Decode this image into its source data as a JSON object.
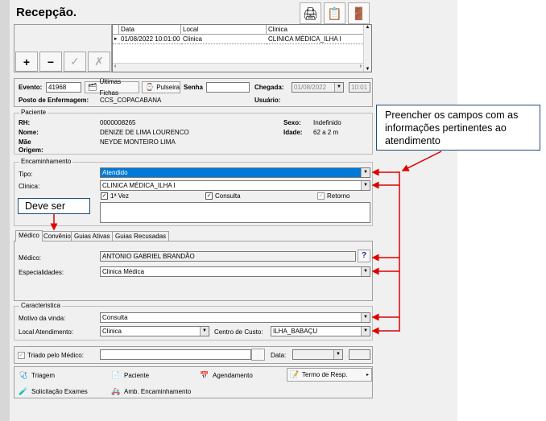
{
  "window": {
    "title": "Recepção."
  },
  "toolbar_icons": [
    "printer-icon",
    "checklist-icon",
    "exit-door-icon"
  ],
  "record_buttons": {
    "add": "+",
    "remove": "−",
    "confirm": "✓",
    "cancel": "✗"
  },
  "grid": {
    "headers": [
      "Data",
      "Local",
      "Clinica"
    ],
    "rows": [
      {
        "data": "01/08/2022 10:01:00",
        "local": "Clinica",
        "clinica": "CLINICA MÉDICA_ILHA I"
      }
    ]
  },
  "event": {
    "evento_label": "Evento:",
    "evento_value": "41968",
    "ultimas_fichas": "Últimas Fichas",
    "pulseira": "Pulseira",
    "senha_label": "Senha",
    "senha_value": "",
    "chegada_label": "Chegada:",
    "chegada_date": "01/08/2022",
    "chegada_time": "10:01",
    "posto_label": "Posto de Enfermagem:",
    "posto_value": "CCS_COPACABANA",
    "usuario_label": "Usuário:"
  },
  "paciente": {
    "group_title": "Paciente",
    "rh_label": "RH:",
    "rh_value": "0000008265",
    "nome_label": "Nome:",
    "nome_value": "DENIZE DE LIMA LOURENCO",
    "mae_label": "Mãe",
    "mae_value": "NEYDE MONTEIRO LIMA",
    "origem_label": "Origem:",
    "sexo_label": "Sexo:",
    "sexo_value": "Indefinido",
    "idade_label": "Idade:",
    "idade_value": "62 a 2 m"
  },
  "encaminhamento": {
    "group_title": "Encaminhamento",
    "tipo_label": "Tipo:",
    "tipo_value": "Atendido",
    "clinica_label": "Clinica:",
    "clinica_value": "CLINICA MÉDICA_ILHA I",
    "primeira_vez": "1ª Vez",
    "consulta": "Consulta",
    "retorno": "Retorno"
  },
  "tabs": [
    "Médico",
    "Convênio",
    "Guias Ativas",
    "Guias Recusadas"
  ],
  "medico": {
    "medico_label": "Médico:",
    "medico_value": "ANTONIO GABRIEL BRANDÃO",
    "help": "?",
    "especialidades_label": "Especialidades:",
    "especialidades_value": "Clinica Médica"
  },
  "caracteristica": {
    "group_title": "Caracteristica",
    "motivo_label": "Motivo da vinda:",
    "motivo_value": "Consulta",
    "local_label": "Local Atendimento:",
    "local_value": "Clinica",
    "centro_label": "Centro de Custo:",
    "centro_value": "ILHA_BABAÇU"
  },
  "triado": {
    "label": "Triado pelo Médico:",
    "data_label": "Data:"
  },
  "actions": {
    "triagem": "Triagem",
    "paciente": "Paciente",
    "agendamento": "Agendamento",
    "termo": "Termo de Resp.",
    "solicitacao": "Solicitação Exames",
    "amb": "Amb. Encaminhamento"
  },
  "annotations": {
    "callout_main": "Preencher os campos com as informações pertinentes ao atendimento",
    "callout_tab": "Deve ser"
  },
  "colors": {
    "selection": "#0078d7",
    "arrow": "#e00000",
    "callout_border": "#1f4e79"
  }
}
